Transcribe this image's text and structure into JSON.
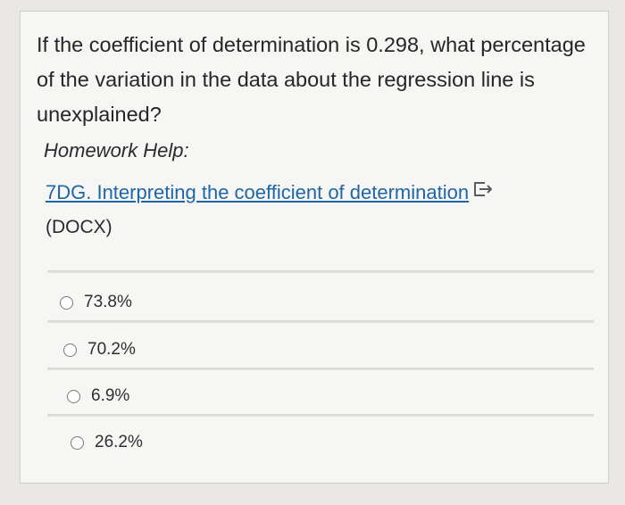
{
  "question": {
    "line1": "If the coefficient of determination is 0.298, what percentage",
    "line2": "of the variation in the data about the regression line is",
    "line3": "unexplained?"
  },
  "help": {
    "label": "Homework Help:",
    "link_text": "7DG. Interpreting the coefficient of determination",
    "link_icon": "external-link-icon",
    "doc_type": "(DOCX)"
  },
  "options": [
    {
      "label": "73.8%"
    },
    {
      "label": "70.2%"
    },
    {
      "label": "6.9%"
    },
    {
      "label": "26.2%"
    }
  ],
  "colors": {
    "link": "#1f66a8",
    "text": "#262626",
    "background": "#f6f6f4"
  }
}
